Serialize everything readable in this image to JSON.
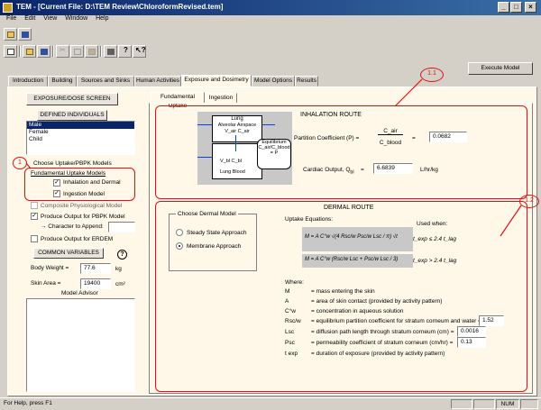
{
  "window": {
    "title": "TEM - [Current File:  D:\\TEM Review\\ChloroformRevised.tem]"
  },
  "menu": [
    "File",
    "Edit",
    "View",
    "Window",
    "Help"
  ],
  "execute_button": "Execute Model",
  "tabs": [
    "Introduction",
    "Building",
    "Sources and Sinks",
    "Human Activities",
    "Exposure and Dosimetry",
    "Model Options",
    "Results"
  ],
  "left": {
    "screen_title": "EXPOSURE/DOSE SCREEN",
    "defined_individuals": "DEFINED INDIVIDUALS",
    "individuals": [
      "Male",
      "Female",
      "Child"
    ],
    "choose_uptake": "Choose Uptake/PBPK Models",
    "fundamental_models": "Fundamental Uptake Models",
    "inhalation_dermal": "Inhalation and Dermal",
    "ingestion_model": "Ingestion Model",
    "composite": "Composite Physiological Model",
    "produce_pbpk": "Produce Output for PBPK Model",
    "character_append": "→ Character to Append:",
    "produce_erdem": "Produce Output for ERDEM",
    "common_vars": "COMMON VARIABLES",
    "help_mark": "?",
    "body_weight_label": "Body Weight  =",
    "body_weight_value": "77.6",
    "body_weight_unit": "kg",
    "skin_area_label": "Skin Area =",
    "skin_area_value": "19400",
    "skin_area_unit": "cm²",
    "model_advisor": "Model Advisor"
  },
  "subtabs": [
    "Fundamental Uptake",
    "Ingestion"
  ],
  "inhalation": {
    "title": "INHALATION ROUTE",
    "diagram": {
      "lung": "Lung",
      "alveolar": "Alveolar Airspace",
      "c_alv": "V_air C_air",
      "equilibrium": "Equilibrium",
      "eq_formula": "C_air/C_blood = P",
      "vbl": "V_bl C_bl",
      "lung_blood": "Lung Blood"
    },
    "partition_label": "Partition Coefficient (P)  =",
    "cair": "C_air",
    "cblood": "C_blood",
    "eq_sign": "=",
    "partition_value": "0.0682",
    "cardiac_label": "Cardiac Output, Q",
    "cardiac_sub": "bl",
    "cardiac_eq": "=",
    "cardiac_value": "6.6839",
    "cardiac_unit": "L/hr/kg"
  },
  "dermal": {
    "title": "DERMAL ROUTE",
    "choose_model": "Choose Dermal Model",
    "steady_state": "Steady State Approach",
    "membrane": "Membrane Approach",
    "uptake_eq": "Uptake Equations:",
    "used_when": "Used when:",
    "eq1": "M = A C°w √(4 Rsc/w Psc/w Lsc / π) √t",
    "eq1_cond": "t_exp ≤ 2.4 t_lag",
    "eq2": "M = A C°w (Rsc/w Lsc + Psc/w Lsc / 3)",
    "eq2_cond": "t_exp > 2.4 t_lag",
    "where": "Where:",
    "definitions": [
      {
        "sym": "M",
        "desc": "=  mass entering the skin",
        "value": ""
      },
      {
        "sym": "A",
        "desc": "=  area of skin contact (provided by activity pattern)",
        "value": ""
      },
      {
        "sym": "C°w",
        "desc": "=  concentration in aqueous solution",
        "value": ""
      },
      {
        "sym": "Rsc/w",
        "desc": "=  equilibrium partition coefficient for stratum corneum and water  =",
        "value": "1.52"
      },
      {
        "sym": "Lsc",
        "desc": "=  diffusion path length through stratum corneum (cm)  =",
        "value": "0.0016"
      },
      {
        "sym": "Psc",
        "desc": "=  permeability coefficient of stratum corneum (cm/hr)  =",
        "value": "0.13"
      },
      {
        "sym": "t exp",
        "desc": "=  duration of exposure (provided by activity pattern)",
        "value": ""
      }
    ]
  },
  "callouts": {
    "c1": "1",
    "c11": "1.1",
    "c12": "1.2"
  },
  "status": {
    "left": "For Help, press F1",
    "num": "NUM"
  },
  "colors": {
    "title_start": "#0a246a",
    "title_end": "#3a6ea5",
    "selection": "#0a246a",
    "callout": "#e01010",
    "panel_bg": "#fff8e8"
  }
}
